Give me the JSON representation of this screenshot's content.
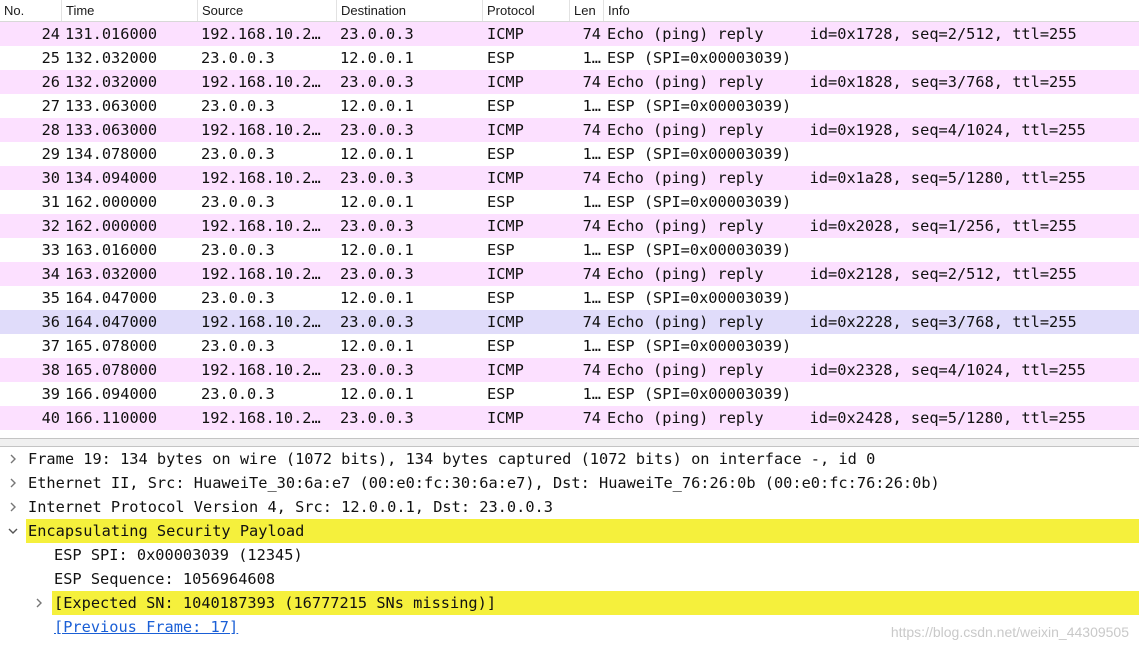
{
  "columns": {
    "no": "No.",
    "time": "Time",
    "source": "Source",
    "destination": "Destination",
    "protocol": "Protocol",
    "length": "Len",
    "info": "Info"
  },
  "colors": {
    "icmp_row": "#fce0ff",
    "esp_row": "#ffffff",
    "selected_row": "#e0dcfa",
    "highlight": "#f5f03c",
    "link": "#1a5fd6"
  },
  "packets": [
    {
      "no": "24",
      "time": "131.016000",
      "source": "192.168.10.2…",
      "destination": "23.0.0.3",
      "protocol": "ICMP",
      "length": "74",
      "info": "Echo (ping) reply     id=0x1728, seq=2/512, ttl=255",
      "type": "icmp"
    },
    {
      "no": "25",
      "time": "132.032000",
      "source": "23.0.0.3",
      "destination": "12.0.0.1",
      "protocol": "ESP",
      "length": "1…",
      "info": "ESP (SPI=0x00003039)",
      "type": "esp"
    },
    {
      "no": "26",
      "time": "132.032000",
      "source": "192.168.10.2…",
      "destination": "23.0.0.3",
      "protocol": "ICMP",
      "length": "74",
      "info": "Echo (ping) reply     id=0x1828, seq=3/768, ttl=255",
      "type": "icmp"
    },
    {
      "no": "27",
      "time": "133.063000",
      "source": "23.0.0.3",
      "destination": "12.0.0.1",
      "protocol": "ESP",
      "length": "1…",
      "info": "ESP (SPI=0x00003039)",
      "type": "esp"
    },
    {
      "no": "28",
      "time": "133.063000",
      "source": "192.168.10.2…",
      "destination": "23.0.0.3",
      "protocol": "ICMP",
      "length": "74",
      "info": "Echo (ping) reply     id=0x1928, seq=4/1024, ttl=255",
      "type": "icmp"
    },
    {
      "no": "29",
      "time": "134.078000",
      "source": "23.0.0.3",
      "destination": "12.0.0.1",
      "protocol": "ESP",
      "length": "1…",
      "info": "ESP (SPI=0x00003039)",
      "type": "esp"
    },
    {
      "no": "30",
      "time": "134.094000",
      "source": "192.168.10.2…",
      "destination": "23.0.0.3",
      "protocol": "ICMP",
      "length": "74",
      "info": "Echo (ping) reply     id=0x1a28, seq=5/1280, ttl=255",
      "type": "icmp"
    },
    {
      "no": "31",
      "time": "162.000000",
      "source": "23.0.0.3",
      "destination": "12.0.0.1",
      "protocol": "ESP",
      "length": "1…",
      "info": "ESP (SPI=0x00003039)",
      "type": "esp"
    },
    {
      "no": "32",
      "time": "162.000000",
      "source": "192.168.10.2…",
      "destination": "23.0.0.3",
      "protocol": "ICMP",
      "length": "74",
      "info": "Echo (ping) reply     id=0x2028, seq=1/256, ttl=255",
      "type": "icmp"
    },
    {
      "no": "33",
      "time": "163.016000",
      "source": "23.0.0.3",
      "destination": "12.0.0.1",
      "protocol": "ESP",
      "length": "1…",
      "info": "ESP (SPI=0x00003039)",
      "type": "esp"
    },
    {
      "no": "34",
      "time": "163.032000",
      "source": "192.168.10.2…",
      "destination": "23.0.0.3",
      "protocol": "ICMP",
      "length": "74",
      "info": "Echo (ping) reply     id=0x2128, seq=2/512, ttl=255",
      "type": "icmp"
    },
    {
      "no": "35",
      "time": "164.047000",
      "source": "23.0.0.3",
      "destination": "12.0.0.1",
      "protocol": "ESP",
      "length": "1…",
      "info": "ESP (SPI=0x00003039)",
      "type": "esp"
    },
    {
      "no": "36",
      "time": "164.047000",
      "source": "192.168.10.2…",
      "destination": "23.0.0.3",
      "protocol": "ICMP",
      "length": "74",
      "info": "Echo (ping) reply     id=0x2228, seq=3/768, ttl=255",
      "type": "selected"
    },
    {
      "no": "37",
      "time": "165.078000",
      "source": "23.0.0.3",
      "destination": "12.0.0.1",
      "protocol": "ESP",
      "length": "1…",
      "info": "ESP (SPI=0x00003039)",
      "type": "esp"
    },
    {
      "no": "38",
      "time": "165.078000",
      "source": "192.168.10.2…",
      "destination": "23.0.0.3",
      "protocol": "ICMP",
      "length": "74",
      "info": "Echo (ping) reply     id=0x2328, seq=4/1024, ttl=255",
      "type": "icmp"
    },
    {
      "no": "39",
      "time": "166.094000",
      "source": "23.0.0.3",
      "destination": "12.0.0.1",
      "protocol": "ESP",
      "length": "1…",
      "info": "ESP (SPI=0x00003039)",
      "type": "esp"
    },
    {
      "no": "40",
      "time": "166.110000",
      "source": "192.168.10.2…",
      "destination": "23.0.0.3",
      "protocol": "ICMP",
      "length": "74",
      "info": "Echo (ping) reply     id=0x2428, seq=5/1280, ttl=255",
      "type": "icmp"
    }
  ],
  "details": [
    {
      "text": "Frame 19: 134 bytes on wire (1072 bits), 134 bytes captured (1072 bits) on interface -, id 0",
      "arrow": "collapsed",
      "indent": 0,
      "highlight": false,
      "link": false
    },
    {
      "text": "Ethernet II, Src: HuaweiTe_30:6a:e7 (00:e0:fc:30:6a:e7), Dst: HuaweiTe_76:26:0b (00:e0:fc:76:26:0b)",
      "arrow": "collapsed",
      "indent": 0,
      "highlight": false,
      "link": false
    },
    {
      "text": "Internet Protocol Version 4, Src: 12.0.0.1, Dst: 23.0.0.3",
      "arrow": "collapsed",
      "indent": 0,
      "highlight": false,
      "link": false
    },
    {
      "text": "Encapsulating Security Payload",
      "arrow": "expanded",
      "indent": 0,
      "highlight": true,
      "link": false
    },
    {
      "text": "ESP SPI: 0x00003039 (12345)",
      "arrow": "none",
      "indent": 1,
      "highlight": false,
      "link": false
    },
    {
      "text": "ESP Sequence: 1056964608",
      "arrow": "none",
      "indent": 1,
      "highlight": false,
      "link": false
    },
    {
      "text": "[Expected SN: 1040187393 (16777215 SNs missing)]",
      "arrow": "collapsed",
      "indent": 1,
      "highlight": true,
      "link": false
    },
    {
      "text": "[Previous Frame: 17]",
      "arrow": "none",
      "indent": 1,
      "highlight": false,
      "link": true
    }
  ],
  "watermark": "https://blog.csdn.net/weixin_44309505"
}
